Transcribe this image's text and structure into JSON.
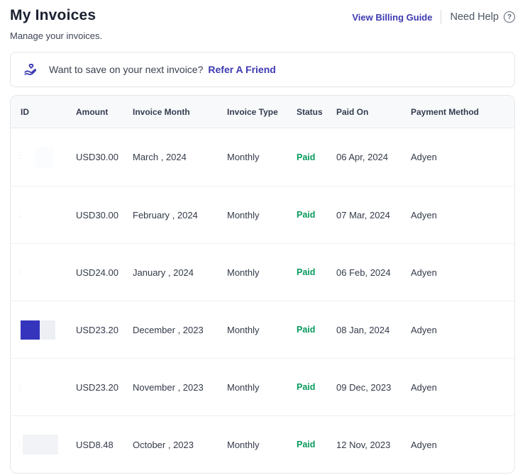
{
  "page": {
    "title": "My Invoices",
    "subtitle": "Manage your invoices."
  },
  "header_links": {
    "billing_guide_label": "View Billing Guide",
    "need_help_label": "Need Help",
    "help_icon": "question-mark-circle"
  },
  "referral_banner": {
    "icon": "hand-holding-heart",
    "message": "Want to save on your next invoice?",
    "link_label": "Refer A Friend"
  },
  "invoice_table": {
    "columns": [
      "ID",
      "Amount",
      "Invoice Month",
      "Invoice Type",
      "Status",
      "Paid On",
      "Payment Method"
    ],
    "rows": [
      {
        "amount": "USD30.00",
        "invoice_month": "March , 2024",
        "invoice_type": "Monthly",
        "status": "Paid",
        "paid_on": "06 Apr, 2024",
        "payment_method": "Adyen"
      },
      {
        "amount": "USD30.00",
        "invoice_month": "February , 2024",
        "invoice_type": "Monthly",
        "status": "Paid",
        "paid_on": "07 Mar, 2024",
        "payment_method": "Adyen"
      },
      {
        "amount": "USD24.00",
        "invoice_month": "January , 2024",
        "invoice_type": "Monthly",
        "status": "Paid",
        "paid_on": "06 Feb, 2024",
        "payment_method": "Adyen"
      },
      {
        "amount": "USD23.20",
        "invoice_month": "December , 2023",
        "invoice_type": "Monthly",
        "status": "Paid",
        "paid_on": "08 Jan, 2024",
        "payment_method": "Adyen"
      },
      {
        "amount": "USD23.20",
        "invoice_month": "November , 2023",
        "invoice_type": "Monthly",
        "status": "Paid",
        "paid_on": "09 Dec, 2023",
        "payment_method": "Adyen"
      },
      {
        "amount": "USD8.48",
        "invoice_month": "October , 2023",
        "invoice_type": "Monthly",
        "status": "Paid",
        "paid_on": "12 Nov, 2023",
        "payment_method": "Adyen"
      }
    ]
  },
  "colors": {
    "accent_indigo": "#3e3ab2",
    "paid_green": "#079a5c",
    "title_dark": "#1b2130",
    "table_header_bg": "#f8f9fb",
    "border_gray": "#e4e7ec",
    "id_highlight_blue": "#3434bd"
  }
}
